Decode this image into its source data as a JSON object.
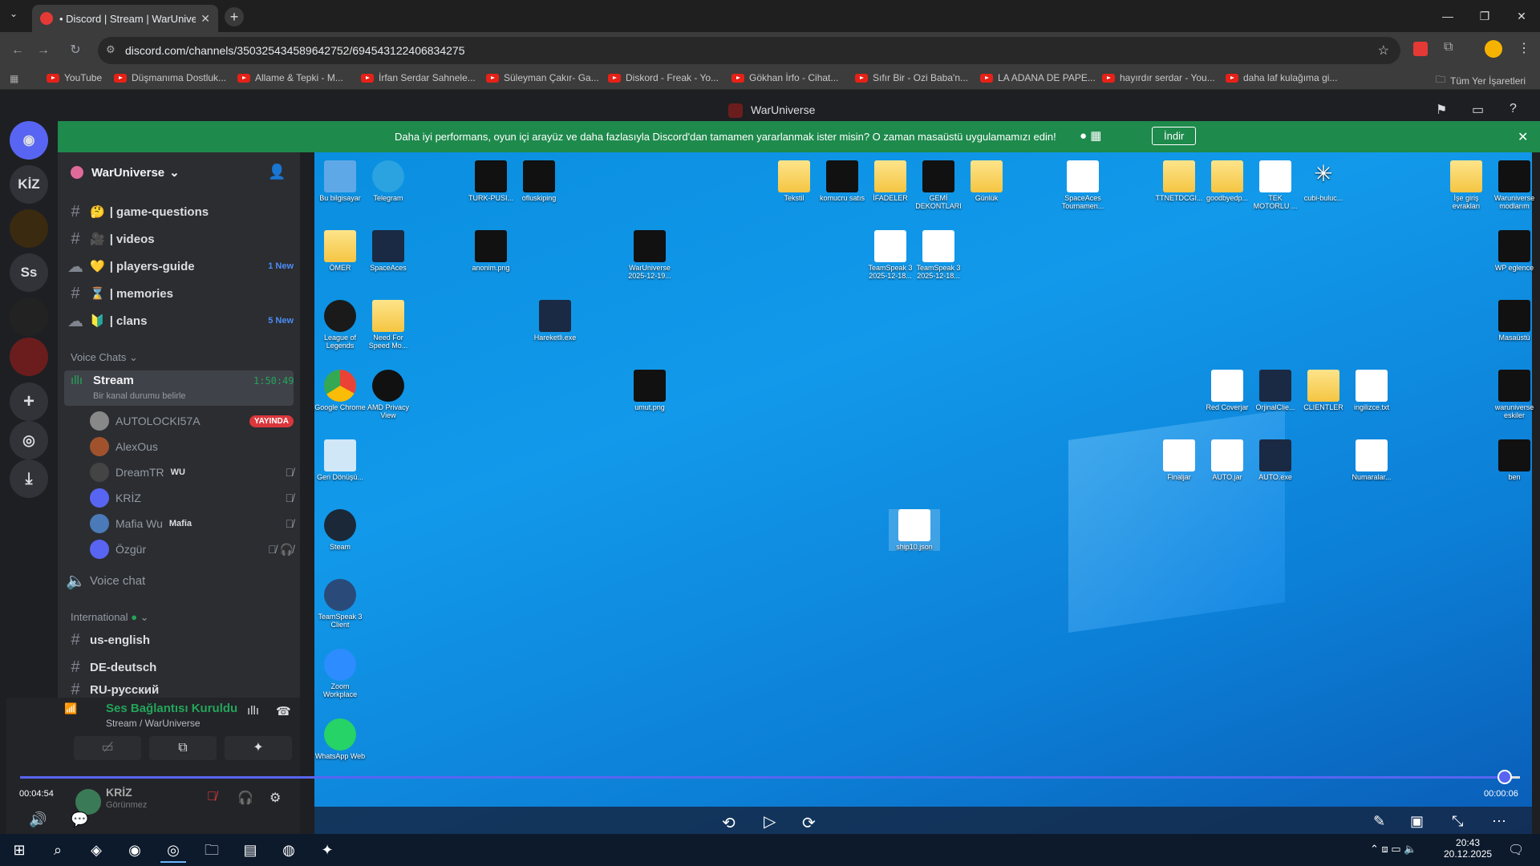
{
  "browser": {
    "tab_title": "• Discord | Stream | WarUniverse",
    "url": "discord.com/channels/350325434589642752/694543122406834275",
    "bookmarks": [
      "YouTube",
      "Düşmanıma Dostluk...",
      "Allame & Tepki - M...",
      "İrfan Serdar Sahnele...",
      "Süleyman Çakır- Ga...",
      "Diskord - Freak - Yo...",
      "Gökhan İrfo - Cihat...",
      "Sıfır Bir - Ozi Baba'n...",
      "LA ADANA DE PAPE...",
      "hayırdır serdar - You...",
      "daha laf kulağıma gi..."
    ],
    "all_bookmarks": "Tüm Yer İşaretleri"
  },
  "discord": {
    "window_title": "WarUniverse",
    "banner_text": "Daha iyi performans, oyun içi arayüz ve daha fazlasıyla Discord'dan tamamen yararlanmak ister misin? O zaman masaüstü uygulamamızı edin!",
    "banner_button": "İndir",
    "rail": [
      "KİZ",
      "Ss"
    ],
    "server_name": "WarUniverse",
    "channels": [
      {
        "emoji": "🤔",
        "name": "| game-questions",
        "badge": ""
      },
      {
        "emoji": "🎥",
        "name": "| videos",
        "badge": ""
      },
      {
        "emoji": "💛",
        "name": "| players-guide",
        "badge": "1 New"
      },
      {
        "emoji": "⌛",
        "name": "| memories",
        "badge": ""
      },
      {
        "emoji": "🔰",
        "name": "| clans",
        "badge": "5 New"
      }
    ],
    "voice_category": "Voice Chats",
    "voice_channel": {
      "name": "Stream",
      "time": "1:50:49",
      "status": "Bir kanal durumu belirle"
    },
    "voice_users": [
      {
        "name": "AUTOLOCKI57A",
        "tag": "YAYINDA"
      },
      {
        "name": "AlexOus",
        "tag": ""
      },
      {
        "name": "DreamTR",
        "tag": "WU"
      },
      {
        "name": "KRİZ",
        "tag": ""
      },
      {
        "name": "Mafia Wu",
        "tag": "Mafia"
      },
      {
        "name": "Özgür",
        "tag": ""
      }
    ],
    "voice_chat": "Voice chat",
    "intl_category": "International",
    "intl_channels": [
      "us-english",
      "DE-deutsch",
      "RU-русский"
    ],
    "connection": {
      "title": "Ses Bağlantısı Kuruldu",
      "sub": "Stream / WarUniverse"
    },
    "user": {
      "name": "KRİZ",
      "status": "Görünmez"
    }
  },
  "player": {
    "current": "00:04:54",
    "remaining": "00:00:06",
    "progress": 0.99
  },
  "desktop_icons": [
    "Bu bilgisayar",
    "Telegram",
    "TURK-PUSI...",
    "ofluskiping",
    "Tekstil",
    "komucru satıs",
    "İFADELER",
    "GEMİ DEKONTLARI",
    "Günlük",
    "SpaceAces Tournamen...",
    "TTNETDCGI...",
    "goodbyedp...",
    "TEK MOTORLU ...",
    "cubi-buluc...",
    "İşe giriş evrakları",
    "Waruniverse modlarım",
    "ÖMER",
    "SpaceAces",
    "anonim.png",
    "WarUniverse 2025-12-19...",
    "TeamSpeak 3 2025-12-18...",
    "TeamSpeak 3 2025-12-18...",
    "WP eglence",
    "League of Legends",
    "Need For Speed Mo...",
    "Hareketli.exe",
    "Masaüstü",
    "Google Chrome",
    "AMD Privacy View",
    "umut.png",
    "Red Coverjar",
    "OrjinalClie...",
    "CLIENTLER",
    "ingilizce.txt",
    "waruniverse eskiler",
    "Geri Dönüşü...",
    "Finaljar",
    "AUTO.jar",
    "AUTO.exe",
    "Numaralar...",
    "ben",
    "Steam",
    "ship10.json",
    "TeamSpeak 3 Client",
    "Zoom Workplace",
    "WhatsApp Web"
  ],
  "clock": {
    "time": "20:43",
    "date": "20.12.2025"
  }
}
